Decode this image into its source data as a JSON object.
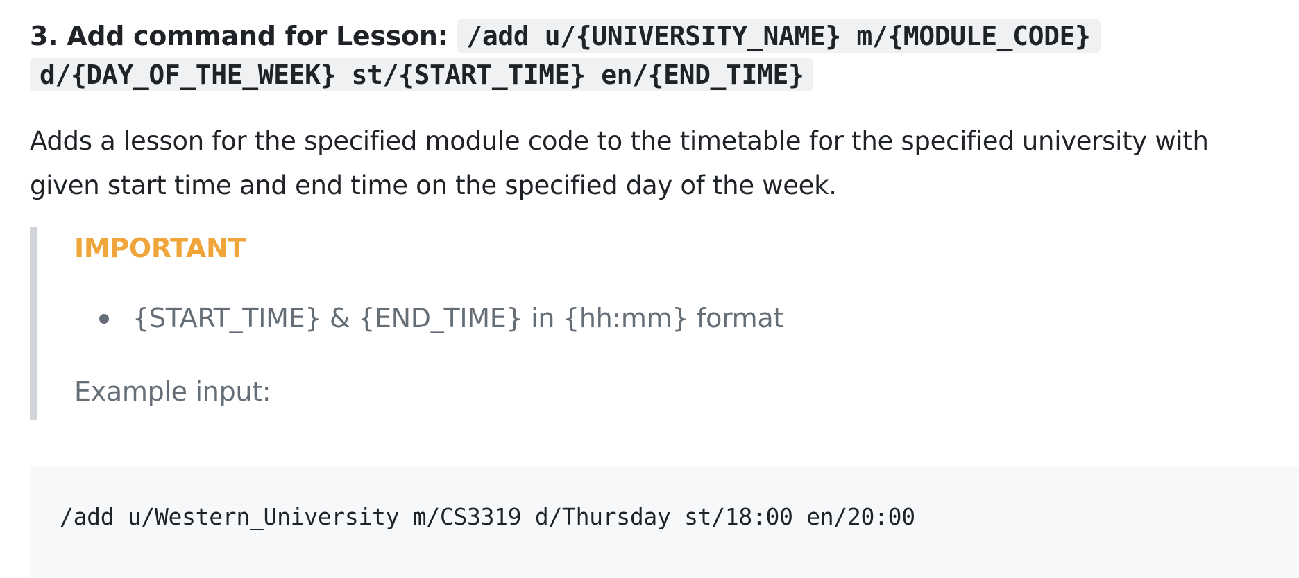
{
  "section": {
    "heading_prefix": "3. Add command for Lesson:",
    "heading_code_line1": "/add u/{UNIVERSITY_NAME} m/{MODULE_CODE}",
    "heading_code_line2": "d/{DAY_OF_THE_WEEK} st/{START_TIME} en/{END_TIME}",
    "description": "Adds a lesson for the specified module code to the timetable for the specified university with given start time and end time on the specified day of the week."
  },
  "note": {
    "title": "IMPORTANT",
    "items": [
      "{START_TIME} & {END_TIME} in {hh:mm} format"
    ],
    "example_label": "Example input:"
  },
  "example": {
    "code": "/add u/Western_University m/CS3319 d/Thursday st/18:00 en/20:00"
  },
  "colors": {
    "note_title": "#f0a53a",
    "note_text": "#656d76",
    "note_border": "#d1d5da",
    "code_background": "#f6f8fa"
  }
}
